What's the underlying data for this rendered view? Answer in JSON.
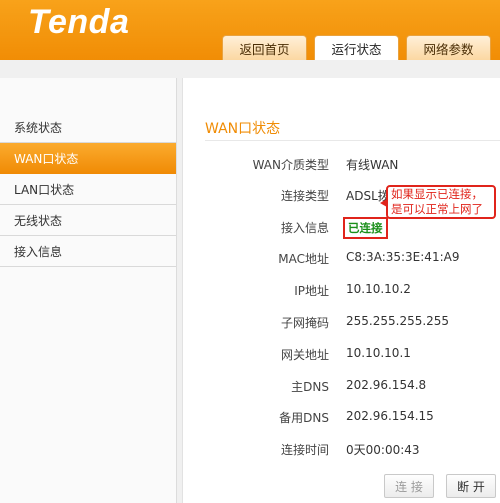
{
  "brand": {
    "logo_text": "Tenda"
  },
  "tabs": [
    {
      "label": "返回首页",
      "active": false
    },
    {
      "label": "运行状态",
      "active": true
    },
    {
      "label": "网络参数",
      "active": false
    }
  ],
  "sidebar": {
    "items": [
      {
        "label": "系统状态",
        "active": false
      },
      {
        "label": "WAN口状态",
        "active": true
      },
      {
        "label": "LAN口状态",
        "active": false
      },
      {
        "label": "无线状态",
        "active": false
      },
      {
        "label": "接入信息",
        "active": false
      }
    ]
  },
  "wan": {
    "title": "WAN口状态",
    "rows": [
      {
        "label": "WAN介质类型",
        "value": "有线WAN"
      },
      {
        "label": "连接类型",
        "value": "ADSL拨号"
      },
      {
        "label": "接入信息",
        "value": "已连接"
      },
      {
        "label": "MAC地址",
        "value": "C8:3A:35:3E:41:A9"
      },
      {
        "label": "IP地址",
        "value": "10.10.10.2"
      },
      {
        "label": "子网掩码",
        "value": "255.255.255.255"
      },
      {
        "label": "网关地址",
        "value": "10.10.10.1"
      },
      {
        "label": "主DNS",
        "value": "202.96.154.8"
      },
      {
        "label": "备用DNS",
        "value": "202.96.154.15"
      },
      {
        "label": "连接时间",
        "value": "0天00:00:43"
      }
    ]
  },
  "annotation": {
    "line1": "如果显示已连接，",
    "line2": "是可以正常上网了"
  },
  "buttons": {
    "connect": "连 接",
    "disconnect": "断 开"
  },
  "colors": {
    "accent": "#f08c05",
    "annotation_red": "#e0241b",
    "connected_green": "#1a8f1a"
  }
}
